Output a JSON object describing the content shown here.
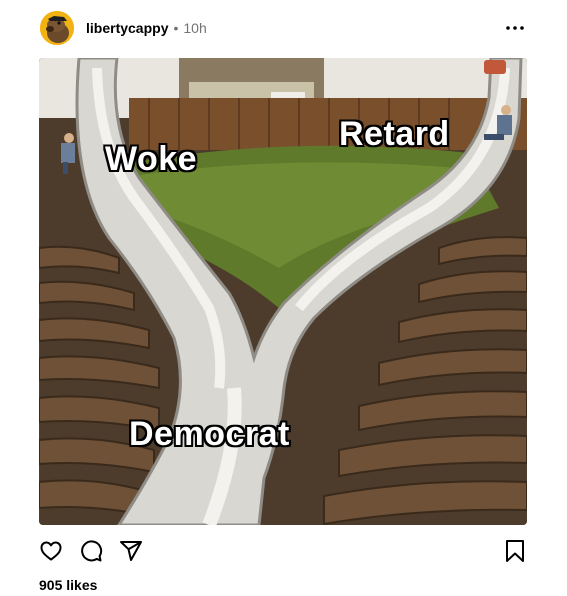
{
  "post": {
    "username": "libertycappy",
    "separator": "•",
    "time": "10h",
    "image_labels": {
      "woke": "Woke",
      "retard": "Retard",
      "democrat": "Democrat"
    },
    "likes_text": "905 likes"
  },
  "icons": {
    "avatar": "avatar-icon",
    "more": "more-horizontal-icon",
    "like": "heart-icon",
    "comment": "comment-icon",
    "share": "share-icon",
    "save": "bookmark-icon"
  },
  "colors": {
    "secondary_text": "#737373",
    "avatar_bg": "#f2b312"
  }
}
